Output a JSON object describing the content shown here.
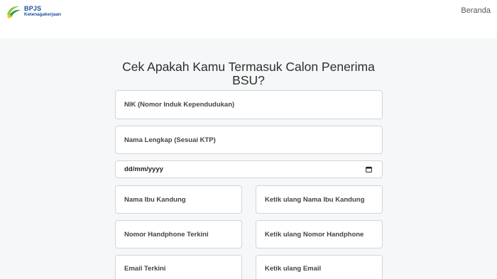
{
  "brand": {
    "name_line1": "BPJS",
    "name_line2": "Ketenagakerjaan"
  },
  "nav": {
    "home_label": "Beranda"
  },
  "form": {
    "title": "Cek Apakah Kamu Termasuk Calon Penerima BSU?",
    "nik_placeholder": "NIK (Nomor Induk Kependudukan)",
    "fullname_placeholder": "Nama Lengkap (Sesuai KTP)",
    "birthdate_placeholder": "dd/mm/yyyy",
    "mother_name_placeholder": "Nama Ibu Kandung",
    "mother_name_confirm_placeholder": "Ketik ulang Nama Ibu Kandung",
    "phone_placeholder": "Nomor Handphone Terkini",
    "phone_confirm_placeholder": "Ketik ulang Nomor Handphone",
    "email_placeholder": "Email Terkini",
    "email_confirm_placeholder": "Ketik ulang Email"
  },
  "colors": {
    "brand_blue": "#1a4fa0",
    "brand_green": "#8dc63f",
    "brand_yellow": "#f5c518",
    "page_background": "#f6f7f8"
  }
}
